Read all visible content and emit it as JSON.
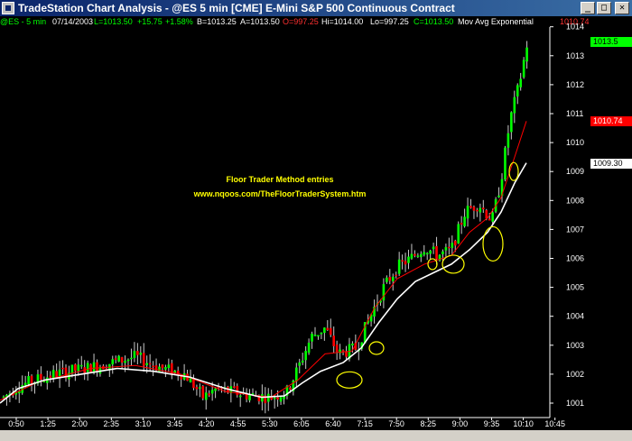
{
  "window": {
    "title": "TradeStation Chart Analysis - @ES  5 min  [CME] E-Mini S&P 500 Continuous Contract",
    "buttons": [
      "_",
      "□",
      "✕"
    ]
  },
  "infobar": {
    "symbol": "@ES - 5 min",
    "date": "07/14/2003",
    "last": "L=1013.50",
    "change": "+15.75",
    "change_pct": "+1.58%",
    "bid": "B=1013.25",
    "ask": "A=1013.50",
    "open": "O=997.25",
    "high": "Hi=1014.00",
    "low": "Lo=997.25",
    "close": "C=1013.50",
    "indicator": "Mov Avg Exponential",
    "indicator_value": "1010.74",
    "colors": {
      "green": "#00ff00",
      "red": "#ff3030",
      "white": "#ffffff"
    }
  },
  "annotation": {
    "line1": "Floor Trader Method entries",
    "line2": "www.nqoos.com/TheFloorTraderSystem.htm"
  },
  "price_tags": {
    "last": "1013.5",
    "ema": "1010.74",
    "ma2": "1009.30"
  },
  "chart_data": {
    "type": "candlestick",
    "y_axis": {
      "ticks": [
        1001,
        1002,
        1003,
        1004,
        1005,
        1006,
        1007,
        1008,
        1009,
        1010,
        1011,
        1012,
        1013,
        1014
      ],
      "range": [
        1000.6,
        1014.3
      ]
    },
    "x_axis": {
      "ticks": [
        "0:50",
        "1:25",
        "2:00",
        "2:35",
        "3:10",
        "3:45",
        "4:20",
        "4:55",
        "5:30",
        "6:05",
        "6:40",
        "7:15",
        "7:50",
        "8:25",
        "9:00",
        "9:35",
        "10:10",
        "10:45"
      ]
    },
    "series": [
      {
        "name": "Mov Avg Exponential",
        "color": "#ff0000"
      },
      {
        "color": "#ffffff"
      }
    ],
    "colors": {
      "up": "#00ff00",
      "down": "#ff0000",
      "circle": "#ffff00"
    }
  }
}
